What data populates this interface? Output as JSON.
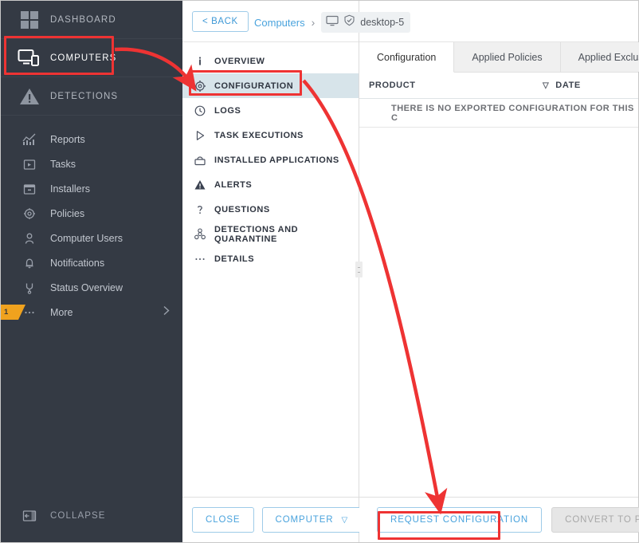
{
  "sidebar": {
    "main_items": [
      {
        "label": "DASHBOARD",
        "icon": "grid-icon",
        "selected": false
      },
      {
        "label": "COMPUTERS",
        "icon": "computers-icon",
        "selected": true
      },
      {
        "label": "DETECTIONS",
        "icon": "warning-triangle-icon",
        "selected": false
      }
    ],
    "sub_items": [
      {
        "label": "Reports",
        "icon": "chart-icon"
      },
      {
        "label": "Tasks",
        "icon": "task-box-icon"
      },
      {
        "label": "Installers",
        "icon": "installer-icon"
      },
      {
        "label": "Policies",
        "icon": "gear-icon"
      },
      {
        "label": "Computer Users",
        "icon": "user-icon"
      },
      {
        "label": "Notifications",
        "icon": "bell-icon"
      },
      {
        "label": "Status Overview",
        "icon": "status-icon"
      },
      {
        "label": "More",
        "icon": "ellipsis-icon",
        "badge": "1",
        "chevron": "›"
      }
    ],
    "collapse": {
      "label": "COLLAPSE",
      "icon": "collapse-panel-icon"
    }
  },
  "breadcrumb": {
    "back_label": "< BACK",
    "parent": "Computers",
    "separator": "›",
    "device": "desktop-5",
    "device_icon": "monitor-icon",
    "device_status_icon": "shield-check-icon"
  },
  "detail_menu": {
    "items": [
      {
        "label": "OVERVIEW",
        "icon": "info-icon",
        "selected": false
      },
      {
        "label": "CONFIGURATION",
        "icon": "gear-icon",
        "selected": true
      },
      {
        "label": "LOGS",
        "icon": "clock-icon",
        "selected": false
      },
      {
        "label": "TASK EXECUTIONS",
        "icon": "play-icon",
        "selected": false
      },
      {
        "label": "INSTALLED APPLICATIONS",
        "icon": "package-icon",
        "selected": false
      },
      {
        "label": "ALERTS",
        "icon": "alert-triangle-icon",
        "selected": false
      },
      {
        "label": "QUESTIONS",
        "icon": "question-icon",
        "selected": false
      },
      {
        "label": "DETECTIONS AND QUARANTINE",
        "icon": "biohazard-icon",
        "selected": false
      },
      {
        "label": "DETAILS",
        "icon": "ellipsis-icon",
        "selected": false
      }
    ]
  },
  "detail_footer": {
    "close_label": "CLOSE",
    "computer_label": "COMPUTER",
    "computer_caret": "▽"
  },
  "main": {
    "tabs": [
      {
        "label": "Configuration",
        "active": true
      },
      {
        "label": "Applied Policies",
        "active": false
      },
      {
        "label": "Applied Exclusions",
        "active": false
      }
    ],
    "columns": [
      {
        "label": "PRODUCT",
        "sort_icon": ""
      },
      {
        "label": "DATE",
        "sort_icon": "▽"
      }
    ],
    "empty_message": "THERE IS NO EXPORTED CONFIGURATION FOR THIS C",
    "footer": {
      "request_label": "REQUEST CONFIGURATION",
      "convert_label": "CONVERT TO POLICY"
    }
  },
  "annotations": {
    "highlight_color": "#ee3333",
    "boxes": [
      {
        "name": "computers-highlight"
      },
      {
        "name": "configuration-highlight"
      },
      {
        "name": "request-configuration-highlight"
      }
    ]
  },
  "colors": {
    "sidebar_bg": "#343a44",
    "selected_row": "#d7e4ea",
    "accent_blue": "#4aa3dd",
    "badge_orange": "#f0a21e",
    "annotation_red": "#ee3333"
  }
}
